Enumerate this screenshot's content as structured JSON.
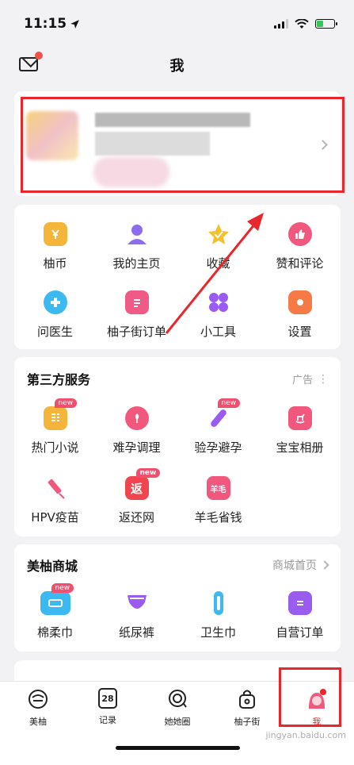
{
  "status_bar": {
    "time": "11:15"
  },
  "nav": {
    "title": "我"
  },
  "menu_grid": {
    "items": [
      {
        "label": "柚币",
        "icon": "coin-icon",
        "color": "#f5b43a"
      },
      {
        "label": "我的主页",
        "icon": "user-icon",
        "color": "#8e6cf0"
      },
      {
        "label": "收藏",
        "icon": "star-icon",
        "color": "#f5c02c"
      },
      {
        "label": "赞和评论",
        "icon": "thumbs-up-icon",
        "color": "#f2587e"
      },
      {
        "label": "问医生",
        "icon": "doctor-icon",
        "color": "#3bb9f0"
      },
      {
        "label": "柚子街订单",
        "icon": "order-icon",
        "color": "#f05a86"
      },
      {
        "label": "小工具",
        "icon": "tools-icon",
        "color": "#9a5cf0"
      },
      {
        "label": "设置",
        "icon": "settings-icon",
        "color": "#f57a45"
      }
    ]
  },
  "third_party": {
    "title": "第三方服务",
    "ad_label": "广告",
    "items": [
      {
        "label": "热门小说",
        "icon": "book-icon",
        "color": "#f5b43a",
        "badge": "new"
      },
      {
        "label": "难孕调理",
        "icon": "flower-icon",
        "color": "#f2587e",
        "badge": ""
      },
      {
        "label": "验孕避孕",
        "icon": "test-stick-icon",
        "color": "#9a5cf0",
        "badge": "new"
      },
      {
        "label": "宝宝相册",
        "icon": "rocking-horse-icon",
        "color": "#f2587e",
        "badge": ""
      },
      {
        "label": "HPV疫苗",
        "icon": "vaccine-icon",
        "color": "#f2587e",
        "badge": ""
      },
      {
        "label": "返还网",
        "icon": "rebate-icon",
        "color": "#f0454e",
        "badge": "new",
        "glyph": "返"
      },
      {
        "label": "羊毛省钱",
        "icon": "savings-icon",
        "color": "#f2587e",
        "badge": "",
        "glyph": "羊毛"
      }
    ]
  },
  "mall": {
    "title": "美柚商城",
    "link_label": "商城首页",
    "items": [
      {
        "label": "棉柔巾",
        "icon": "tissue-icon",
        "color": "#3bb9f0",
        "badge": "new"
      },
      {
        "label": "纸尿裤",
        "icon": "diaper-icon",
        "color": "#9a5cf0",
        "badge": ""
      },
      {
        "label": "卫生巾",
        "icon": "sanitary-pad-icon",
        "color": "#3bb9f0",
        "badge": ""
      },
      {
        "label": "自营订单",
        "icon": "self-order-icon",
        "color": "#9a5cf0",
        "badge": ""
      }
    ]
  },
  "tabbar": {
    "items": [
      {
        "label": "美柚",
        "icon": "meiyou-icon"
      },
      {
        "label": "记录",
        "icon": "calendar-icon",
        "glyph": "28"
      },
      {
        "label": "她她圈",
        "icon": "circle-icon"
      },
      {
        "label": "柚子街",
        "icon": "shopping-bag-icon"
      },
      {
        "label": "我",
        "icon": "profile-icon",
        "active": true
      }
    ]
  },
  "accent_color": "#e8262b",
  "watermark": "jingyan.baidu.com"
}
